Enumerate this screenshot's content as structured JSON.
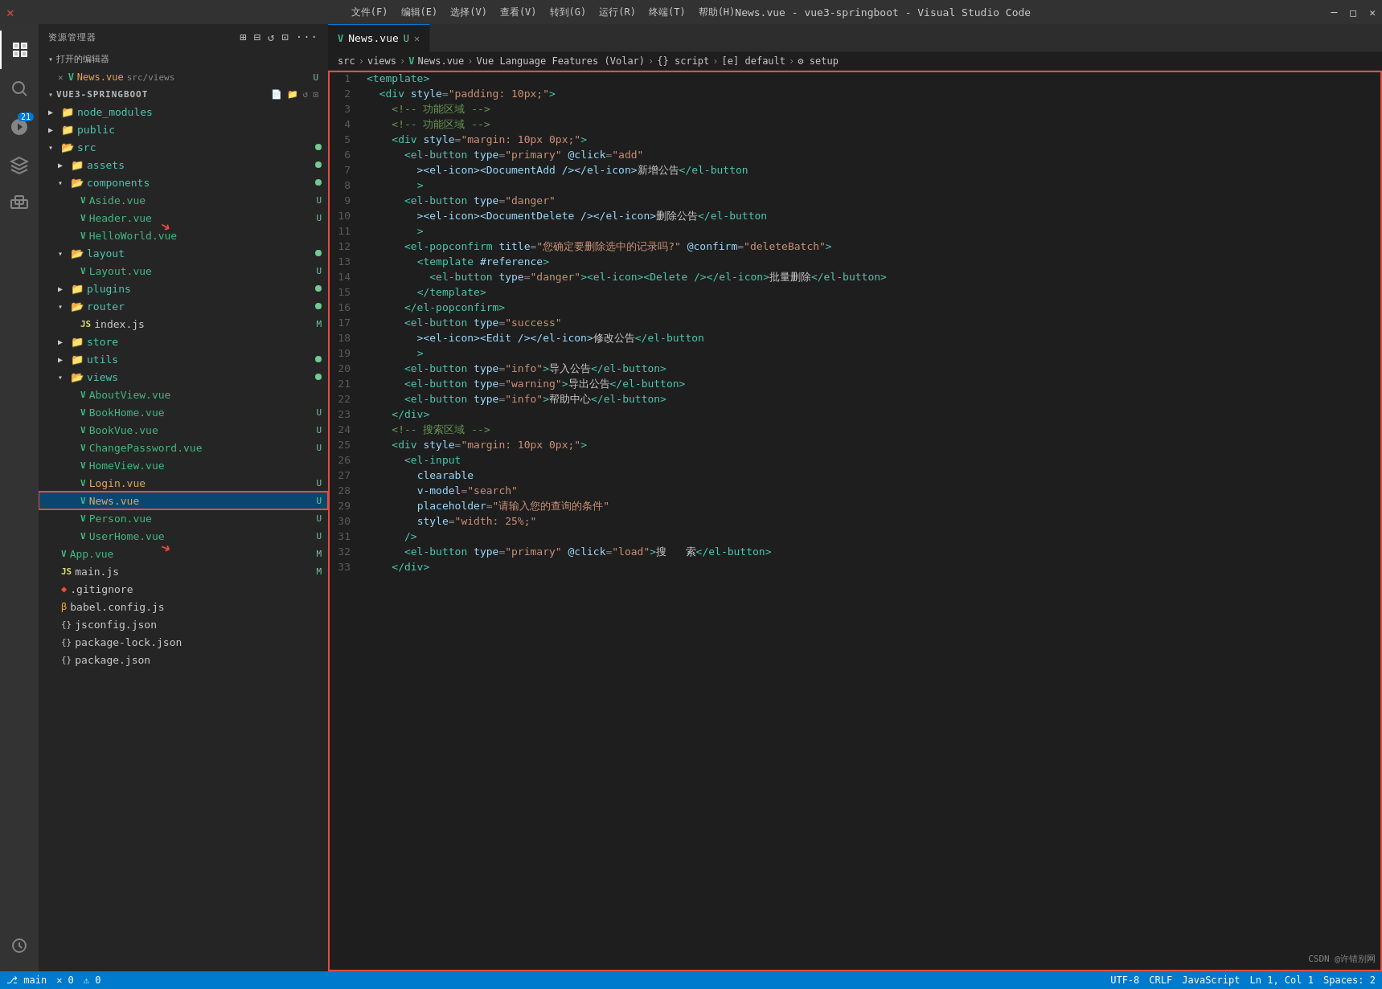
{
  "titleBar": {
    "title": "News.vue - vue3-springboot - Visual Studio Code",
    "menus": [
      "文件(F)",
      "编辑(E)",
      "选择(V)",
      "查看(V)",
      "转到(G)",
      "运行(R)",
      "终端(T)",
      "帮助(H)"
    ]
  },
  "sidebar": {
    "header": "资源管理器",
    "openEditors": {
      "label": "打开的编辑器",
      "files": [
        {
          "name": "News.vue",
          "path": "src/views",
          "badge": "U",
          "modified": true
        }
      ]
    },
    "projectName": "VUE3-SPRINGBOOT",
    "tree": [
      {
        "indent": 12,
        "type": "folder",
        "name": "node_modules",
        "open": false,
        "badge": ""
      },
      {
        "indent": 12,
        "type": "folder",
        "name": "public",
        "open": false,
        "badge": ""
      },
      {
        "indent": 12,
        "type": "folder",
        "name": "src",
        "open": true,
        "badge": "dot"
      },
      {
        "indent": 24,
        "type": "folder",
        "name": "assets",
        "open": false,
        "badge": "dot"
      },
      {
        "indent": 24,
        "type": "folder",
        "name": "components",
        "open": true,
        "badge": "dot"
      },
      {
        "indent": 36,
        "type": "vue",
        "name": "Aside.vue",
        "badge": "U"
      },
      {
        "indent": 36,
        "type": "vue",
        "name": "Header.vue",
        "badge": "U"
      },
      {
        "indent": 36,
        "type": "vue",
        "name": "HelloWorld.vue",
        "badge": ""
      },
      {
        "indent": 24,
        "type": "folder",
        "name": "layout",
        "open": true,
        "badge": "dot"
      },
      {
        "indent": 36,
        "type": "vue",
        "name": "Layout.vue",
        "badge": "U"
      },
      {
        "indent": 24,
        "type": "folder",
        "name": "plugins",
        "open": false,
        "badge": "dot"
      },
      {
        "indent": 24,
        "type": "folder",
        "name": "router",
        "open": false,
        "badge": "dot"
      },
      {
        "indent": 36,
        "type": "js",
        "name": "index.js",
        "badge": "M"
      },
      {
        "indent": 24,
        "type": "folder",
        "name": "store",
        "open": false,
        "badge": ""
      },
      {
        "indent": 24,
        "type": "folder",
        "name": "utils",
        "open": false,
        "badge": "dot"
      },
      {
        "indent": 24,
        "type": "folder",
        "name": "views",
        "open": true,
        "badge": "dot"
      },
      {
        "indent": 36,
        "type": "vue",
        "name": "AboutView.vue",
        "badge": ""
      },
      {
        "indent": 36,
        "type": "vue",
        "name": "BookHome.vue",
        "badge": "U"
      },
      {
        "indent": 36,
        "type": "vue",
        "name": "BookVue.vue",
        "badge": "U"
      },
      {
        "indent": 36,
        "type": "vue",
        "name": "ChangePassword.vue",
        "badge": "U"
      },
      {
        "indent": 36,
        "type": "vue",
        "name": "HomeView.vue",
        "badge": ""
      },
      {
        "indent": 36,
        "type": "vue",
        "name": "Login.vue",
        "badge": "U"
      },
      {
        "indent": 36,
        "type": "vue",
        "name": "News.vue",
        "badge": "U",
        "selected": true
      },
      {
        "indent": 36,
        "type": "vue",
        "name": "Person.vue",
        "badge": "U"
      },
      {
        "indent": 36,
        "type": "vue",
        "name": "UserHome.vue",
        "badge": "U"
      },
      {
        "indent": 12,
        "type": "vue",
        "name": "App.vue",
        "badge": "M"
      },
      {
        "indent": 12,
        "type": "js",
        "name": "main.js",
        "badge": "M"
      },
      {
        "indent": 12,
        "type": "gitignore",
        "name": ".gitignore",
        "badge": ""
      },
      {
        "indent": 12,
        "type": "babel",
        "name": "babel.config.js",
        "badge": ""
      },
      {
        "indent": 12,
        "type": "json",
        "name": "jsconfig.json",
        "badge": ""
      },
      {
        "indent": 12,
        "type": "json",
        "name": "package-lock.json",
        "badge": ""
      },
      {
        "indent": 12,
        "type": "json",
        "name": "package.json",
        "badge": ""
      }
    ]
  },
  "editor": {
    "tab": {
      "name": "News.vue",
      "modified": "U"
    },
    "breadcrumb": "src > views > News.vue > Vue Language Features (Volar) > {} script > [e] default > ⚙ setup",
    "lines": [
      {
        "n": 1,
        "html": "<span class='t-tag'>&lt;template&gt;</span>"
      },
      {
        "n": 2,
        "html": "  <span class='t-tag'>&lt;div</span> <span class='t-attr'>style</span><span class='t-punct'>=</span><span class='t-string'>\"padding: 10px;\"</span><span class='t-tag'>&gt;</span>"
      },
      {
        "n": 3,
        "html": "    <span class='t-comment'>&lt;!-- 功能区域 --&gt;</span>"
      },
      {
        "n": 4,
        "html": "    <span class='t-comment'>&lt;!-- 功能区域 --&gt;</span>"
      },
      {
        "n": 5,
        "html": "    <span class='t-tag'>&lt;div</span> <span class='t-attr'>style</span><span class='t-punct'>=</span><span class='t-string'>\"margin: 10px 0px;\"</span><span class='t-tag'>&gt;</span>"
      },
      {
        "n": 6,
        "html": "      <span class='t-tag'>&lt;el-button</span> <span class='t-attr'>type</span><span class='t-punct'>=</span><span class='t-string'>\"primary\"</span> <span class='t-attr'>@click</span><span class='t-punct'>=</span><span class='t-string'>\"add\"</span>"
      },
      {
        "n": 7,
        "html": "        <span class='t-tag'>&gt;&lt;el-icon&gt;&lt;DocumentAdd /&gt;&lt;/el-icon&gt;</span><span class='t-text'>新增公告</span><span class='t-tag'>&lt;/el-button</span>"
      },
      {
        "n": 8,
        "html": "        <span class='t-tag'>&gt;</span>"
      },
      {
        "n": 9,
        "html": "      <span class='t-tag'>&lt;el-button</span> <span class='t-attr'>type</span><span class='t-punct'>=</span><span class='t-string'>\"danger\"</span>"
      },
      {
        "n": 10,
        "html": "        <span class='t-tag'>&gt;&lt;el-icon&gt;&lt;DocumentDelete /&gt;&lt;/el-icon&gt;</span><span class='t-text'>删除公告</span><span class='t-tag'>&lt;/el-button</span>"
      },
      {
        "n": 11,
        "html": "        <span class='t-tag'>&gt;</span>"
      },
      {
        "n": 12,
        "html": "      <span class='t-tag'>&lt;el-popconfirm</span> <span class='t-attr'>title</span><span class='t-punct'>=</span><span class='t-string'>\"您确定要删除选中的记录吗?\"</span> <span class='t-attr'>@confirm</span><span class='t-punct'>=</span><span class='t-string'>\"deleteBatch\"</span><span class='t-tag'>&gt;</span>"
      },
      {
        "n": 13,
        "html": "        <span class='t-tag'>&lt;template</span> <span class='t-attr'>#reference</span><span class='t-tag'>&gt;</span>"
      },
      {
        "n": 14,
        "html": "          <span class='t-tag'>&lt;el-button</span> <span class='t-attr'>type</span><span class='t-punct'>=</span><span class='t-string'>\"danger\"</span><span class='t-tag'>&gt;&lt;el-icon&gt;&lt;Delete /&gt;&lt;/el-icon&gt;</span><span class='t-text'>批量删除</span><span class='t-tag'>&lt;/el-button&gt;</span>"
      },
      {
        "n": 15,
        "html": "        <span class='t-tag'>&lt;/template&gt;</span>"
      },
      {
        "n": 16,
        "html": "      <span class='t-tag'>&lt;/el-popconfirm&gt;</span>"
      },
      {
        "n": 17,
        "html": "      <span class='t-tag'>&lt;el-button</span> <span class='t-attr'>type</span><span class='t-punct'>=</span><span class='t-string'>\"success\"</span>"
      },
      {
        "n": 18,
        "html": "        <span class='t-tag'>&gt;&lt;el-icon&gt;&lt;Edit /&gt;&lt;/el-icon&gt;</span><span class='t-text'>修改公告</span><span class='t-tag'>&lt;/el-button</span>"
      },
      {
        "n": 19,
        "html": "        <span class='t-tag'>&gt;</span>"
      },
      {
        "n": 20,
        "html": "      <span class='t-tag'>&lt;el-button</span> <span class='t-attr'>type</span><span class='t-punct'>=</span><span class='t-string'>\"info\"</span><span class='t-tag'>&gt;</span><span class='t-text'>导入公告</span><span class='t-tag'>&lt;/el-button&gt;</span>"
      },
      {
        "n": 21,
        "html": "      <span class='t-tag'>&lt;el-button</span> <span class='t-attr'>type</span><span class='t-punct'>=</span><span class='t-string'>\"warning\"</span><span class='t-tag'>&gt;</span><span class='t-text'>导出公告</span><span class='t-tag'>&lt;/el-button&gt;</span>"
      },
      {
        "n": 22,
        "html": "      <span class='t-tag'>&lt;el-button</span> <span class='t-attr'>type</span><span class='t-punct'>=</span><span class='t-string'>\"info\"</span><span class='t-tag'>&gt;</span><span class='t-text'>帮助中心</span><span class='t-tag'>&lt;/el-button&gt;</span>"
      },
      {
        "n": 23,
        "html": "    <span class='t-tag'>&lt;/div&gt;</span>"
      },
      {
        "n": 24,
        "html": "    <span class='t-comment'>&lt;!-- 搜索区域 --&gt;</span>"
      },
      {
        "n": 25,
        "html": "    <span class='t-tag'>&lt;div</span> <span class='t-attr'>style</span><span class='t-punct'>=</span><span class='t-string'>\"margin: 10px 0px;\"</span><span class='t-tag'>&gt;</span>"
      },
      {
        "n": 26,
        "html": "      <span class='t-tag'>&lt;el-input</span>"
      },
      {
        "n": 27,
        "html": "        <span class='t-attr'>clearable</span>"
      },
      {
        "n": 28,
        "html": "        <span class='t-attr'>v-model</span><span class='t-punct'>=</span><span class='t-string'>\"search\"</span>"
      },
      {
        "n": 29,
        "html": "        <span class='t-attr'>placeholder</span><span class='t-punct'>=</span><span class='t-string'>\"请输入您的查询的条件\"</span>"
      },
      {
        "n": 30,
        "html": "        <span class='t-attr'>style</span><span class='t-punct'>=</span><span class='t-string'>\"width: 25%;\"</span>"
      },
      {
        "n": 31,
        "html": "      <span class='t-tag'>/&gt;</span>"
      },
      {
        "n": 32,
        "html": "      <span class='t-tag'>&lt;el-button</span> <span class='t-attr'>type</span><span class='t-punct'>=</span><span class='t-string'>\"primary\"</span> <span class='t-attr'>@click</span><span class='t-punct'>=</span><span class='t-string'>\"load\"</span><span class='t-tag'>&gt;</span><span class='t-text'>搜&amp;nbsp;&amp;nbsp;&amp;nbsp;索</span><span class='t-tag'>&lt;/el-button&gt;</span>"
      },
      {
        "n": 33,
        "html": "    <span class='t-tag'>&lt;/div&gt;</span>"
      }
    ]
  },
  "statusBar": {
    "branch": "main",
    "errors": "0",
    "warnings": "0",
    "right": [
      "UTF-8",
      "CRLF",
      "JavaScript",
      "Ln 1, Col 1",
      "Spaces: 2"
    ]
  },
  "watermark": "CSDN @许错别网"
}
